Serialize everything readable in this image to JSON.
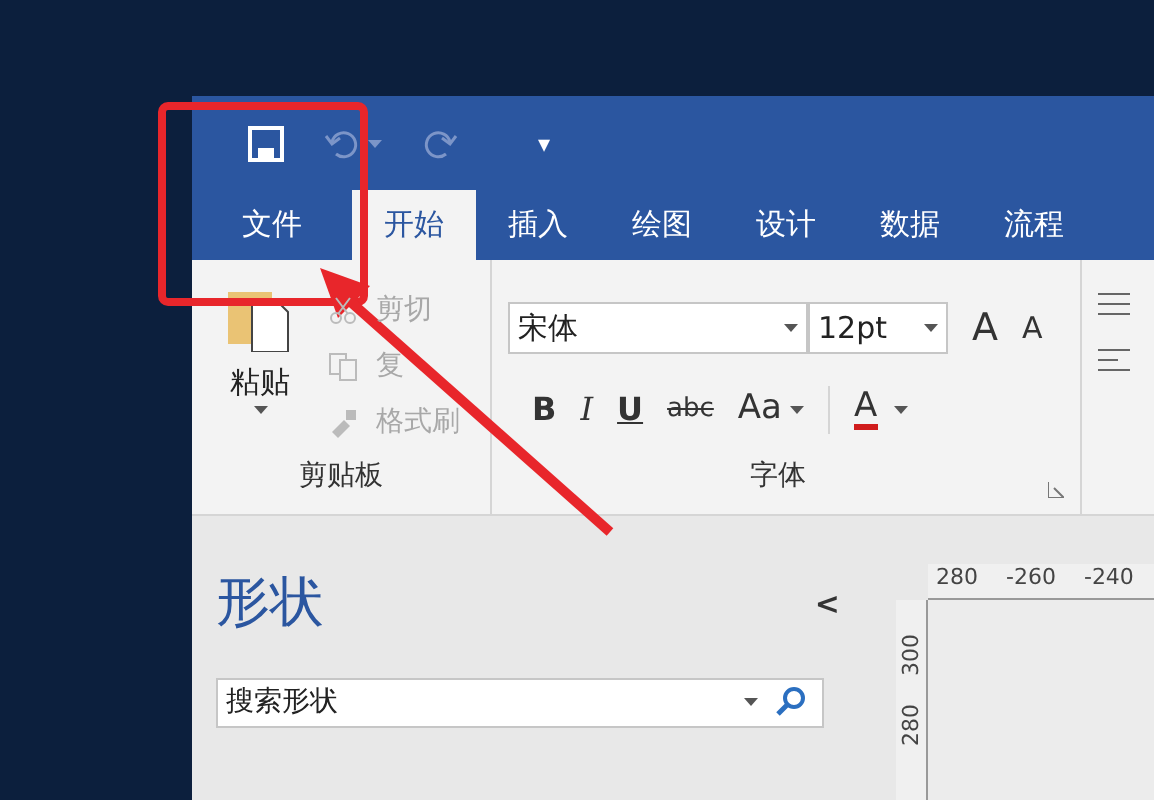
{
  "quick_access": {
    "customize": "▾"
  },
  "tabs": [
    {
      "label": "文件",
      "selected": false
    },
    {
      "label": "开始",
      "selected": true
    },
    {
      "label": "插入",
      "selected": false
    },
    {
      "label": "绘图",
      "selected": false
    },
    {
      "label": "设计",
      "selected": false
    },
    {
      "label": "数据",
      "selected": false
    },
    {
      "label": "流程",
      "selected": false
    }
  ],
  "clipboard": {
    "paste": "粘贴",
    "items": [
      {
        "label": "剪切",
        "kind": "cut",
        "disabled": true
      },
      {
        "label": "复",
        "kind": "copy",
        "disabled": true
      },
      {
        "label": "格式刷",
        "kind": "painter",
        "disabled": true
      }
    ],
    "group_label": "剪贴板"
  },
  "font": {
    "font_name": "宋体",
    "font_size": "12pt",
    "grow": "A",
    "shrink": "A",
    "format_buttons": [
      {
        "label": "B",
        "kind": "bold"
      },
      {
        "label": "I",
        "kind": "italic"
      },
      {
        "label": "U",
        "kind": "underline"
      },
      {
        "label": "abc",
        "kind": "strike"
      },
      {
        "label": "Aa",
        "kind": "case"
      }
    ],
    "font_color": {
      "label": "A",
      "color": "#d01c1c"
    },
    "group_label": "字体"
  },
  "shapes_pane": {
    "title": "形状",
    "collapse": "<",
    "search_placeholder": "搜索形状"
  },
  "ruler": {
    "horizontal": [
      "280",
      "-260",
      "-240"
    ],
    "vertical": [
      "300",
      "280"
    ]
  }
}
